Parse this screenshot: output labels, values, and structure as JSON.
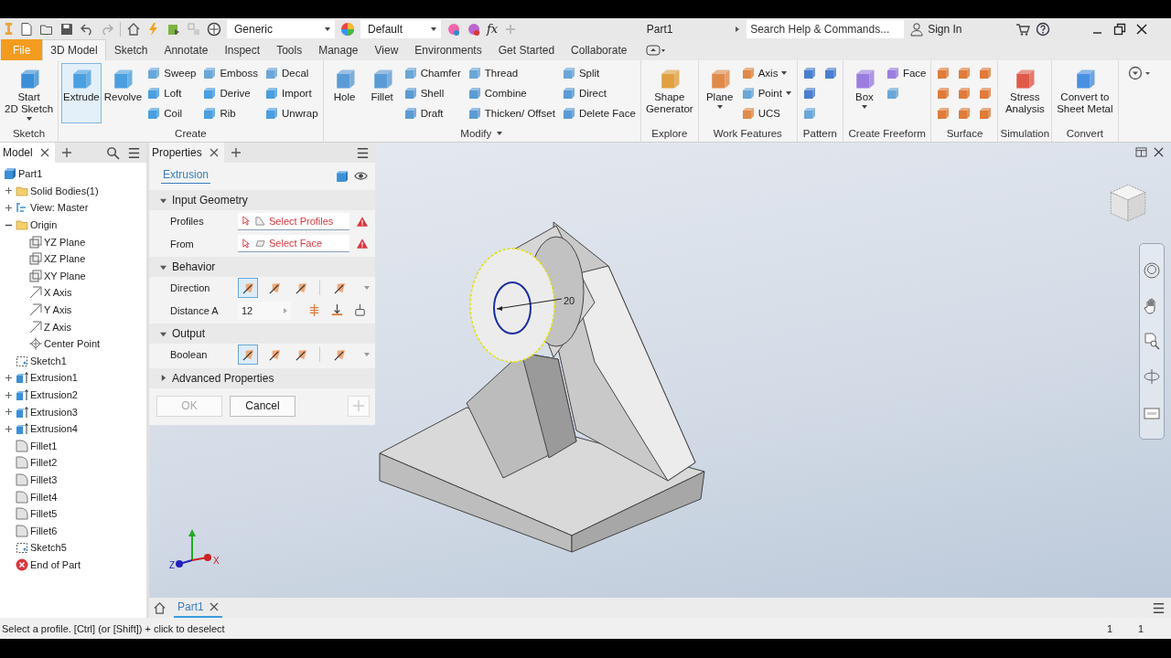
{
  "title_bar": {
    "material": "Generic",
    "appearance": "Default",
    "parameters": "fx",
    "document": "Part1",
    "search": {
      "placeholder": "Search Help & Commands..."
    },
    "account": "Sign In"
  },
  "tabs": [
    {
      "label": "File",
      "kind": "file",
      "selected": false
    },
    {
      "label": "3D Model",
      "kind": "tab",
      "selected": true
    },
    {
      "label": "Sketch",
      "kind": "tab",
      "selected": false
    },
    {
      "label": "Annotate",
      "kind": "tab",
      "selected": false
    },
    {
      "label": "Inspect",
      "kind": "tab",
      "selected": false
    },
    {
      "label": "Tools",
      "kind": "tab",
      "selected": false
    },
    {
      "label": "Manage",
      "kind": "tab",
      "selected": false
    },
    {
      "label": "View",
      "kind": "tab",
      "selected": false
    },
    {
      "label": "Environments",
      "kind": "tab",
      "selected": false
    },
    {
      "label": "Get Started",
      "kind": "tab",
      "selected": false
    },
    {
      "label": "Collaborate",
      "kind": "tab",
      "selected": false
    }
  ],
  "ribbon": [
    {
      "title": "Sketch",
      "menu": false,
      "tools": [
        {
          "kind": "large",
          "label": "Start\n2D Sketch",
          "active": false,
          "dropdown": true
        }
      ]
    },
    {
      "title": "Create",
      "menu": false,
      "tools": [
        {
          "kind": "large",
          "label": "Extrude",
          "active": true,
          "dropdown": false
        },
        {
          "kind": "large",
          "label": "Revolve",
          "active": false,
          "dropdown": false
        },
        {
          "kind": "small",
          "label": "Sweep",
          "active": false,
          "dropdown": false
        },
        {
          "kind": "small",
          "label": "Loft",
          "active": false,
          "dropdown": false
        },
        {
          "kind": "small",
          "label": "Coil",
          "active": false,
          "dropdown": false
        },
        {
          "kind": "small",
          "label": "Emboss",
          "active": false,
          "dropdown": false
        },
        {
          "kind": "small",
          "label": "Derive",
          "active": false,
          "dropdown": false
        },
        {
          "kind": "small",
          "label": "Rib",
          "active": false,
          "dropdown": false
        },
        {
          "kind": "small",
          "label": "Decal",
          "active": false,
          "dropdown": false
        },
        {
          "kind": "small",
          "label": "Import",
          "active": false,
          "dropdown": false
        },
        {
          "kind": "small",
          "label": "Unwrap",
          "active": false,
          "dropdown": false
        }
      ]
    },
    {
      "title": "Modify",
      "menu": true,
      "tools": [
        {
          "kind": "large",
          "label": "Hole",
          "active": false,
          "dropdown": false
        },
        {
          "kind": "large",
          "label": "Fillet",
          "active": false,
          "dropdown": false
        },
        {
          "kind": "small",
          "label": "Chamfer",
          "active": false,
          "dropdown": false
        },
        {
          "kind": "small",
          "label": "Shell",
          "active": false,
          "dropdown": false
        },
        {
          "kind": "small",
          "label": "Draft",
          "active": false,
          "dropdown": false
        },
        {
          "kind": "small",
          "label": "Thread",
          "active": false,
          "dropdown": false
        },
        {
          "kind": "small",
          "label": "Combine",
          "active": false,
          "dropdown": false
        },
        {
          "kind": "small",
          "label": "Thicken/ Offset",
          "active": false,
          "dropdown": false
        },
        {
          "kind": "small",
          "label": "Split",
          "active": false,
          "dropdown": false
        },
        {
          "kind": "small",
          "label": "Direct",
          "active": false,
          "dropdown": false
        },
        {
          "kind": "small",
          "label": "Delete Face",
          "active": false,
          "dropdown": false
        }
      ]
    },
    {
      "title": "Explore",
      "menu": false,
      "tools": [
        {
          "kind": "large",
          "label": "Shape\nGenerator",
          "active": false,
          "dropdown": false
        }
      ]
    },
    {
      "title": "Work Features",
      "menu": false,
      "tools": [
        {
          "kind": "large",
          "label": "Plane",
          "active": false,
          "dropdown": true
        },
        {
          "kind": "small",
          "label": "Axis",
          "active": false,
          "dropdown": true
        },
        {
          "kind": "small",
          "label": "Point",
          "active": false,
          "dropdown": true
        },
        {
          "kind": "small",
          "label": "UCS",
          "active": false,
          "dropdown": false
        }
      ]
    },
    {
      "title": "Pattern",
      "menu": false,
      "tools": [
        {
          "kind": "icon",
          "active": false,
          "dropdown": false
        },
        {
          "kind": "icon",
          "active": false,
          "dropdown": false
        },
        {
          "kind": "icon",
          "active": false,
          "dropdown": false
        },
        {
          "kind": "icon",
          "active": false,
          "dropdown": false
        }
      ]
    },
    {
      "title": "Create Freeform",
      "menu": false,
      "tools": [
        {
          "kind": "large",
          "label": "Box",
          "active": false,
          "dropdown": true
        },
        {
          "kind": "small",
          "label": "Face",
          "active": false,
          "dropdown": false
        },
        {
          "kind": "icon",
          "active": false,
          "dropdown": false
        }
      ]
    },
    {
      "title": "Surface",
      "menu": false,
      "tools": [
        {
          "kind": "icon",
          "active": false,
          "dropdown": false
        },
        {
          "kind": "icon",
          "active": false,
          "dropdown": false
        },
        {
          "kind": "icon",
          "active": false,
          "dropdown": false
        },
        {
          "kind": "icon",
          "active": false,
          "dropdown": false
        },
        {
          "kind": "icon",
          "active": false,
          "dropdown": false
        },
        {
          "kind": "icon",
          "active": false,
          "dropdown": false
        },
        {
          "kind": "icon",
          "active": false,
          "dropdown": false
        },
        {
          "kind": "icon",
          "active": false,
          "dropdown": false
        },
        {
          "kind": "icon",
          "active": false,
          "dropdown": false
        }
      ]
    },
    {
      "title": "Simulation",
      "menu": false,
      "tools": [
        {
          "kind": "large",
          "label": "Stress\nAnalysis",
          "active": false,
          "dropdown": false
        }
      ]
    },
    {
      "title": "Convert",
      "menu": false,
      "tools": [
        {
          "kind": "large",
          "label": "Convert to\nSheet Metal",
          "active": false,
          "dropdown": false
        }
      ]
    }
  ],
  "browser": {
    "tab": "Model",
    "tree": [
      {
        "label": "Part1",
        "kind": "part",
        "children": [
          {
            "label": "Solid Bodies(1)",
            "kind": "folder",
            "expanded": false
          },
          {
            "label": "View: Master",
            "kind": "view",
            "expanded": false
          },
          {
            "label": "Origin",
            "kind": "folder",
            "expanded": true,
            "children": [
              {
                "label": "YZ Plane",
                "kind": "plane"
              },
              {
                "label": "XZ Plane",
                "kind": "plane"
              },
              {
                "label": "XY Plane",
                "kind": "plane"
              },
              {
                "label": "X Axis",
                "kind": "axis"
              },
              {
                "label": "Y Axis",
                "kind": "axis"
              },
              {
                "label": "Z Axis",
                "kind": "axis"
              },
              {
                "label": "Center Point",
                "kind": "point"
              }
            ]
          },
          {
            "label": "Sketch1",
            "kind": "sketch"
          },
          {
            "label": "Extrusion1",
            "kind": "extrusion",
            "expanded": false
          },
          {
            "label": "Extrusion2",
            "kind": "extrusion",
            "expanded": false
          },
          {
            "label": "Extrusion3",
            "kind": "extrusion",
            "expanded": false
          },
          {
            "label": "Extrusion4",
            "kind": "extrusion",
            "expanded": false
          },
          {
            "label": "Fillet1",
            "kind": "fillet"
          },
          {
            "label": "Fillet2",
            "kind": "fillet"
          },
          {
            "label": "Fillet3",
            "kind": "fillet"
          },
          {
            "label": "Fillet4",
            "kind": "fillet"
          },
          {
            "label": "Fillet5",
            "kind": "fillet"
          },
          {
            "label": "Fillet6",
            "kind": "fillet"
          },
          {
            "label": "Sketch5",
            "kind": "sketch"
          },
          {
            "label": "End of Part",
            "kind": "end"
          }
        ]
      }
    ]
  },
  "properties": {
    "tab": "Properties",
    "feature": "Extrusion",
    "sections": [
      {
        "title": "Input Geometry",
        "expanded": true,
        "rows": [
          {
            "kind": "select",
            "label": "Profiles",
            "value": "Select Profiles",
            "warning": true
          },
          {
            "kind": "select",
            "label": "From",
            "value": "Select Face",
            "warning": true
          }
        ]
      },
      {
        "title": "Behavior",
        "expanded": true,
        "rows": [
          {
            "kind": "toggles",
            "label": "Direction",
            "options": [
              {
                "selected": true
              },
              {
                "selected": false
              },
              {
                "selected": false
              },
              {
                "selected": false
              }
            ]
          },
          {
            "kind": "number",
            "label": "Distance A",
            "value": "12"
          }
        ]
      },
      {
        "title": "Output",
        "expanded": true,
        "rows": [
          {
            "kind": "toggles",
            "label": "Boolean",
            "options": [
              {
                "selected": true
              },
              {
                "selected": false
              },
              {
                "selected": false
              },
              {
                "selected": false
              }
            ]
          }
        ]
      },
      {
        "title": "Advanced Properties",
        "expanded": false
      }
    ],
    "buttons": [
      {
        "label": "OK",
        "disabled": true
      },
      {
        "label": "Cancel",
        "disabled": false
      }
    ]
  },
  "viewport": {
    "dimension": "20",
    "triad": [
      "Z",
      "X"
    ]
  },
  "document_tabs": [
    {
      "label": "Part1",
      "selected": true
    }
  ],
  "status_bar": {
    "message": "Select a profile. [Ctrl] (or [Shift]) + click to deselect",
    "readouts": [
      "1",
      "1"
    ]
  }
}
